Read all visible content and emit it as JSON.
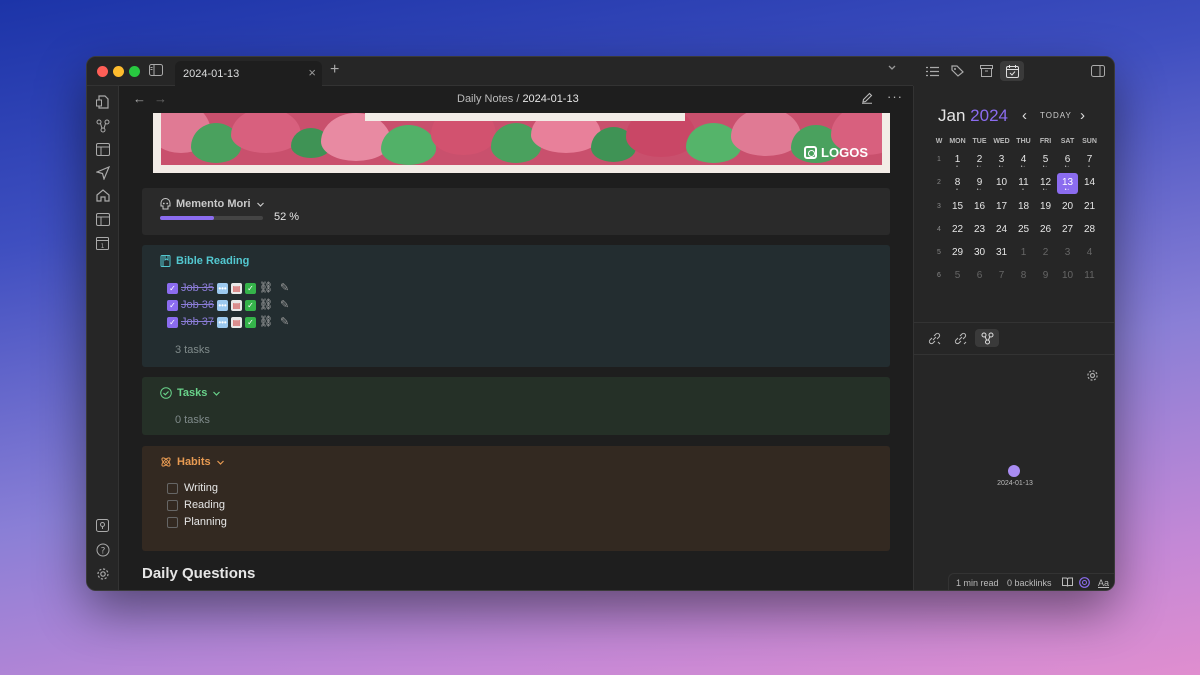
{
  "window": {
    "tab_title": "2024-01-13",
    "tab_close": "×",
    "new_tab": "+",
    "tab_dropdown": "⌄"
  },
  "navbar": {
    "back": "←",
    "forward": "→",
    "breadcrumb_folder": "Daily Notes",
    "breadcrumb_sep": "/",
    "breadcrumb_current": "2024-01-13",
    "more": "···"
  },
  "banner": {
    "logo_text": "LOGOS"
  },
  "memento": {
    "title": "Memento Mori",
    "progress_percent": 52,
    "progress_text": "52 %"
  },
  "bible_reading": {
    "title": "Bible Reading",
    "tasks": [
      {
        "label": "Job 35",
        "done": true
      },
      {
        "label": "Job 36",
        "done": true
      },
      {
        "label": "Job 37",
        "done": true
      }
    ],
    "count_text": "3 tasks"
  },
  "tasks": {
    "title": "Tasks",
    "count_text": "0 tasks"
  },
  "habits": {
    "title": "Habits",
    "items": [
      {
        "label": "Writing",
        "done": false
      },
      {
        "label": "Reading",
        "done": false
      },
      {
        "label": "Planning",
        "done": false
      }
    ]
  },
  "heading": {
    "daily_questions": "Daily Questions"
  },
  "calendar": {
    "month": "Jan",
    "year": "2024",
    "prev": "‹",
    "today_label": "TODAY",
    "next": "›",
    "weekdays": [
      "W",
      "MON",
      "TUE",
      "WED",
      "THU",
      "FRI",
      "SAT",
      "SUN"
    ],
    "weeks": [
      {
        "num": "1",
        "days": [
          {
            "d": "1",
            "dots": "•"
          },
          {
            "d": "2",
            "dots": "•◦"
          },
          {
            "d": "3",
            "dots": "•◦"
          },
          {
            "d": "4",
            "dots": "•◦"
          },
          {
            "d": "5",
            "dots": "•◦"
          },
          {
            "d": "6",
            "dots": "•◦"
          },
          {
            "d": "7",
            "dots": "•"
          }
        ]
      },
      {
        "num": "2",
        "days": [
          {
            "d": "8",
            "dots": "•"
          },
          {
            "d": "9",
            "dots": "•◦"
          },
          {
            "d": "10",
            "dots": "•"
          },
          {
            "d": "11",
            "dots": "•"
          },
          {
            "d": "12",
            "dots": "•◦"
          },
          {
            "d": "13",
            "dots": "•◦",
            "today": true
          },
          {
            "d": "14",
            "dots": ""
          }
        ]
      },
      {
        "num": "3",
        "days": [
          {
            "d": "15"
          },
          {
            "d": "16"
          },
          {
            "d": "17"
          },
          {
            "d": "18"
          },
          {
            "d": "19"
          },
          {
            "d": "20"
          },
          {
            "d": "21"
          }
        ]
      },
      {
        "num": "4",
        "days": [
          {
            "d": "22"
          },
          {
            "d": "23"
          },
          {
            "d": "24"
          },
          {
            "d": "25"
          },
          {
            "d": "26"
          },
          {
            "d": "27"
          },
          {
            "d": "28"
          }
        ]
      },
      {
        "num": "5",
        "days": [
          {
            "d": "29"
          },
          {
            "d": "30"
          },
          {
            "d": "31"
          },
          {
            "d": "1",
            "adj": true
          },
          {
            "d": "2",
            "adj": true
          },
          {
            "d": "3",
            "adj": true
          },
          {
            "d": "4",
            "adj": true
          }
        ]
      },
      {
        "num": "6",
        "days": [
          {
            "d": "5",
            "adj": true
          },
          {
            "d": "6",
            "adj": true
          },
          {
            "d": "7",
            "adj": true
          },
          {
            "d": "8",
            "adj": true
          },
          {
            "d": "9",
            "adj": true
          },
          {
            "d": "10",
            "adj": true
          },
          {
            "d": "11",
            "adj": true
          }
        ]
      }
    ]
  },
  "graph": {
    "node_label": "2024-01-13"
  },
  "status_bar": {
    "read_time": "1 min read",
    "backlinks": "0 backlinks",
    "aa": "Aa"
  },
  "colors": {
    "accent": "#8b6cef",
    "bible": "#53c8d0",
    "tasks": "#69d28a",
    "habits": "#e79a52"
  }
}
